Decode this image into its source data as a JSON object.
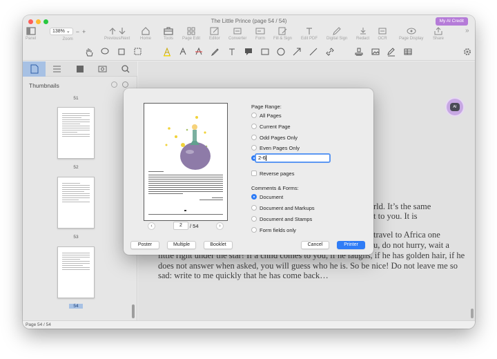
{
  "window": {
    "title": "The Little Prince (page 54 / 54)"
  },
  "credit_button": "My AI Credit",
  "toolbar": {
    "zoom_value": "138%",
    "buttons": [
      "Panel",
      "Zoom",
      "Previous/Next",
      "Home",
      "Tools",
      "Page Edit",
      "Editor",
      "Converter",
      "Form",
      "Fill & Sign",
      "Edit PDF",
      "Digital Sign",
      "Redact",
      "OCR",
      "Page Display",
      "Share"
    ]
  },
  "sidebar": {
    "title": "Thumbnails",
    "page_labels": [
      "51",
      "52",
      "53",
      "54"
    ]
  },
  "document": {
    "lines": [
      "rld. It’s the same",
      "t to you. It is",
      "travel to Africa one",
      "u, do not hurry, wait a",
      "little right under the star! If a child comes to you, if he laughs, if he has golden hair, if he",
      "does not answer when asked, you will guess who he is. So be nice! Do not leave me so",
      "sad: write to me quickly that he has come back…"
    ]
  },
  "status": {
    "page_indicator": "Page 54 / 54"
  },
  "dialog": {
    "page_range_label": "Page Range:",
    "range_options": [
      "All Pages",
      "Current Page",
      "Odd Pages Only",
      "Even Pages Only"
    ],
    "range_value": "2-6",
    "reverse_label": "Reverse pages",
    "comments_label": "Comments & Forms:",
    "comments_options": [
      "Document",
      "Document and Markups",
      "Document and Stamps",
      "Form fields only"
    ],
    "page_input": "2",
    "page_total": "/ 54",
    "prev": "‹",
    "next": "›",
    "buttons": {
      "poster": "Poster",
      "multiple": "Multiple",
      "booklet": "Booklet",
      "cancel": "Cancel",
      "print": "Printer"
    }
  },
  "avatar_text": "AI",
  "colors": {
    "accent": "#2f7cf6",
    "credit": "#b57bd8",
    "sidebar_tab_active": "#a7c1e4"
  }
}
